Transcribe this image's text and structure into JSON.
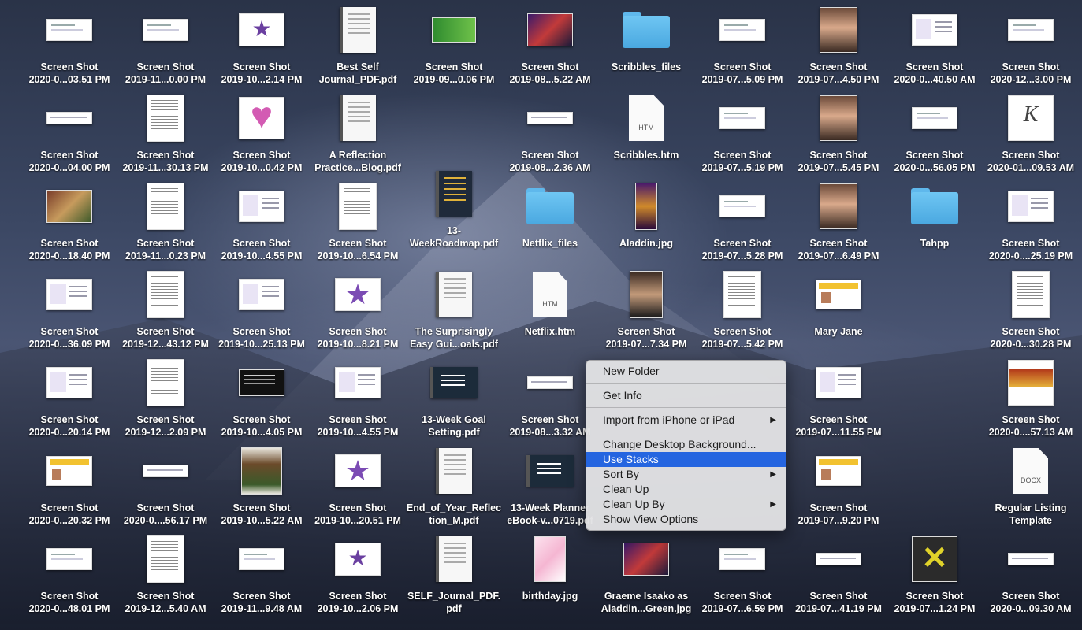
{
  "desktop": {
    "items": [
      {
        "thumb": "wide",
        "icon": "screenshot-icon",
        "line1": "Screen Shot",
        "line2": "2020-0...03.51 PM"
      },
      {
        "thumb": "wide",
        "icon": "screenshot-icon",
        "line1": "Screen Shot",
        "line2": "2019-11...0.00 PM"
      },
      {
        "thumb": "purple",
        "icon": "screenshot-icon",
        "line1": "Screen Shot",
        "line2": "2019-10...2.14 PM"
      },
      {
        "thumb": "pdf",
        "icon": "pdf-document-icon",
        "line1": "Best Self",
        "line2": "Journal_PDF.pdf"
      },
      {
        "thumb": "green",
        "icon": "screenshot-icon",
        "line1": "Screen Shot",
        "line2": "2019-09...0.06 PM"
      },
      {
        "thumb": "concert",
        "icon": "screenshot-icon",
        "line1": "Screen Shot",
        "line2": "2019-08...5.22 AM"
      },
      {
        "thumb": "folder",
        "icon": "folder-icon",
        "line1": "Scribbles_files",
        "line2": ""
      },
      {
        "thumb": "wide",
        "icon": "screenshot-icon",
        "line1": "Screen Shot",
        "line2": "2019-07...5.09 PM"
      },
      {
        "thumb": "face",
        "icon": "screenshot-icon",
        "line1": "Screen Shot",
        "line2": "2019-07...4.50 PM"
      },
      {
        "thumb": "square",
        "icon": "screenshot-icon",
        "line1": "Screen Shot",
        "line2": "2020-0...40.50 AM"
      },
      {
        "thumb": "wide",
        "icon": "screenshot-icon",
        "line1": "Screen Shot",
        "line2": "2020-12...3.00 PM"
      },
      {
        "thumb": "thin",
        "icon": "screenshot-icon",
        "line1": "Screen Shot",
        "line2": "2020-0...04.00 PM"
      },
      {
        "thumb": "doc",
        "icon": "screenshot-icon",
        "line1": "Screen Shot",
        "line2": "2019-11...30.13 PM"
      },
      {
        "thumb": "heart",
        "icon": "screenshot-icon",
        "line1": "Screen Shot",
        "line2": "2019-10...0.42 PM"
      },
      {
        "thumb": "pdf",
        "icon": "pdf-document-icon",
        "line1": "A Reflection",
        "line2": "Practice...Blog.pdf"
      },
      {
        "thumb": "thin",
        "icon": "screenshot-icon",
        "line1": "Screen Shot",
        "line2": "2019-08...2.36 AM"
      },
      {
        "thumb": "htm",
        "icon": "htm-file-icon",
        "line1": "Scribbles.htm",
        "line2": ""
      },
      {
        "thumb": "wide",
        "icon": "screenshot-icon",
        "line1": "Screen Shot",
        "line2": "2019-07...5.19 PM"
      },
      {
        "thumb": "face",
        "icon": "screenshot-icon",
        "line1": "Screen Shot",
        "line2": "2019-07...5.45 PM"
      },
      {
        "thumb": "wide",
        "icon": "screenshot-icon",
        "line1": "Screen Shot",
        "line2": "2020-0...56.05 PM"
      },
      {
        "thumb": "klush",
        "icon": "screenshot-icon",
        "line1": "Screen Shot",
        "line2": "2020-01...09.53 AM"
      },
      {
        "thumb": "photo",
        "icon": "screenshot-icon",
        "line1": "Screen Shot",
        "line2": "2020-0...18.40 PM"
      },
      {
        "thumb": "doc",
        "icon": "screenshot-icon",
        "line1": "Screen Shot",
        "line2": "2019-11...0.23 PM"
      },
      {
        "thumb": "square",
        "icon": "screenshot-icon",
        "line1": "Screen Shot",
        "line2": "2019-10...4.55 PM"
      },
      {
        "thumb": "doc",
        "icon": "screenshot-icon",
        "line1": "Screen Shot",
        "line2": "2019-10...6.54 PM"
      },
      {
        "thumb": "pdfdark",
        "icon": "pdf-document-icon",
        "line1": "13-",
        "line2": "WeekRoadmap.pdf"
      },
      {
        "thumb": "folder",
        "icon": "folder-icon",
        "line1": "Netflix_files",
        "line2": ""
      },
      {
        "thumb": "poster",
        "icon": "image-file-icon",
        "line1": "Aladdin.jpg",
        "line2": ""
      },
      {
        "thumb": "wide",
        "icon": "screenshot-icon",
        "line1": "Screen Shot",
        "line2": "2019-07...5.28 PM"
      },
      {
        "thumb": "face",
        "icon": "screenshot-icon",
        "line1": "Screen Shot",
        "line2": "2019-07...6.49 PM"
      },
      {
        "thumb": "folder",
        "icon": "folder-icon",
        "line1": "Tahpp",
        "line2": ""
      },
      {
        "thumb": "square",
        "icon": "screenshot-icon",
        "line1": "Screen Shot",
        "line2": "2020-0....25.19 PM"
      },
      {
        "thumb": "square",
        "icon": "screenshot-icon",
        "line1": "Screen Shot",
        "line2": "2020-0...36.09 PM"
      },
      {
        "thumb": "doc",
        "icon": "screenshot-icon",
        "line1": "Screen Shot",
        "line2": "2019-12...43.12 PM"
      },
      {
        "thumb": "square",
        "icon": "screenshot-icon",
        "line1": "Screen Shot",
        "line2": "2019-10...25.13 PM"
      },
      {
        "thumb": "star",
        "icon": "screenshot-icon",
        "line1": "Screen Shot",
        "line2": "2019-10...8.21 PM"
      },
      {
        "thumb": "pdf",
        "icon": "pdf-document-icon",
        "line1": "The Surprisingly",
        "line2": "Easy Gui...oals.pdf"
      },
      {
        "thumb": "htm",
        "icon": "htm-file-icon",
        "line1": "Netflix.htm",
        "line2": ""
      },
      {
        "thumb": "pic2",
        "icon": "screenshot-icon",
        "line1": "Screen Shot",
        "line2": "2019-07...7.34 PM"
      },
      {
        "thumb": "doc",
        "icon": "screenshot-icon",
        "line1": "Screen Shot",
        "line2": "2019-07...5.42 PM"
      },
      {
        "thumb": "yellow",
        "icon": "screenshot-icon",
        "line1": "Mary Jane",
        "line2": ""
      },
      {
        "thumb": "doc",
        "icon": "screenshot-icon",
        "line1": "Screen Shot",
        "line2": "2020-0...30.28 PM"
      },
      {
        "thumb": "square",
        "icon": "screenshot-icon",
        "line1": "Screen Shot",
        "line2": "2020-0...20.14 PM"
      },
      {
        "thumb": "doc",
        "icon": "screenshot-icon",
        "line1": "Screen Shot",
        "line2": "2019-12...2.09 PM"
      },
      {
        "thumb": "dark",
        "icon": "screenshot-icon",
        "line1": "Screen Shot",
        "line2": "2019-10...4.05 PM"
      },
      {
        "thumb": "square",
        "icon": "screenshot-icon",
        "line1": "Screen Shot",
        "line2": "2019-10...4.55 PM"
      },
      {
        "thumb": "pdflandscape",
        "icon": "pdf-document-icon",
        "line1": "13-Week Goal",
        "line2": "Setting.pdf"
      },
      {
        "thumb": "thin",
        "icon": "screenshot-icon",
        "line1": "Screen Shot",
        "line2": "2019-08...3.32 AM"
      },
      {
        "thumb": "square",
        "icon": "screenshot-icon",
        "line1": "Screen Shot",
        "line2": "2019-07...11.55 PM"
      },
      {
        "thumb": "food",
        "icon": "screenshot-icon",
        "line1": "Screen Shot",
        "line2": "2020-0....57.13 AM"
      },
      {
        "thumb": "yellow",
        "icon": "screenshot-icon",
        "line1": "Screen Shot",
        "line2": "2020-0...20.32 PM"
      },
      {
        "thumb": "thin",
        "icon": "screenshot-icon",
        "line1": "Screen Shot",
        "line2": "2020-0....56.17 PM"
      },
      {
        "thumb": "bag",
        "icon": "screenshot-icon",
        "line1": "Screen Shot",
        "line2": "2019-10...5.22 AM"
      },
      {
        "thumb": "star",
        "icon": "screenshot-icon",
        "line1": "Screen Shot",
        "line2": "2019-10...20.51 PM"
      },
      {
        "thumb": "pdf",
        "icon": "pdf-document-icon",
        "line1": "End_of_Year_Reflec",
        "line2": "tion_M.pdf"
      },
      {
        "thumb": "pdflandscape",
        "icon": "pdf-document-icon",
        "line1": "13-Week Planner",
        "line2": "eBook-v...0719.pdf"
      },
      {
        "thumb": "yellow",
        "icon": "screenshot-icon",
        "line1": "Screen Shot",
        "line2": "2019-07...9.20 PM"
      },
      {
        "thumb": "docx",
        "icon": "docx-file-icon",
        "line1": "Regular Listing",
        "line2": "Template"
      },
      {
        "thumb": "wide",
        "icon": "screenshot-icon",
        "line1": "Screen Shot",
        "line2": "2020-0...48.01 PM"
      },
      {
        "thumb": "doc",
        "icon": "screenshot-icon",
        "line1": "Screen Shot",
        "line2": "2019-12...5.40 AM"
      },
      {
        "thumb": "wide",
        "icon": "screenshot-icon",
        "line1": "Screen Shot",
        "line2": "2019-11...9.48 AM"
      },
      {
        "thumb": "purple",
        "icon": "screenshot-icon",
        "line1": "Screen Shot",
        "line2": "2019-10...2.06 PM"
      },
      {
        "thumb": "pdf",
        "icon": "pdf-document-icon",
        "line1": "SELF_Journal_PDF.",
        "line2": "pdf"
      },
      {
        "thumb": "pink",
        "icon": "image-file-icon",
        "line1": "birthday.jpg",
        "line2": ""
      },
      {
        "thumb": "concert",
        "icon": "image-file-icon",
        "line1": "Graeme Isaako as",
        "line2": "Aladdin...Green.jpg"
      },
      {
        "thumb": "wide",
        "icon": "screenshot-icon",
        "line1": "Screen Shot",
        "line2": "2019-07...6.59 PM"
      },
      {
        "thumb": "thin",
        "icon": "screenshot-icon",
        "line1": "Screen Shot",
        "line2": "2019-07...41.19 PM"
      },
      {
        "thumb": "xlogo",
        "icon": "screenshot-icon",
        "line1": "Screen Shot",
        "line2": "2019-07...1.24 PM"
      },
      {
        "thumb": "thin",
        "icon": "screenshot-icon",
        "line1": "Screen Shot",
        "line2": "2020-0...09.30 AM"
      }
    ],
    "file_badges": {
      "htm": "HTM",
      "docx": "DOCX"
    }
  },
  "context_menu": {
    "items": [
      {
        "label": "New Folder",
        "submenu": false,
        "selected": false
      },
      {
        "label": "Get Info",
        "submenu": false,
        "selected": false
      },
      {
        "label": "Import from iPhone or iPad",
        "submenu": true,
        "selected": false
      },
      {
        "label": "Change Desktop Background...",
        "submenu": false,
        "selected": false
      },
      {
        "label": "Use Stacks",
        "submenu": false,
        "selected": true
      },
      {
        "label": "Sort By",
        "submenu": true,
        "selected": false
      },
      {
        "label": "Clean Up",
        "submenu": false,
        "selected": false
      },
      {
        "label": "Clean Up By",
        "submenu": true,
        "selected": false
      },
      {
        "label": "Show View Options",
        "submenu": false,
        "selected": false
      }
    ],
    "submenu_arrow": "▶",
    "accent_color": "#2565e0"
  }
}
